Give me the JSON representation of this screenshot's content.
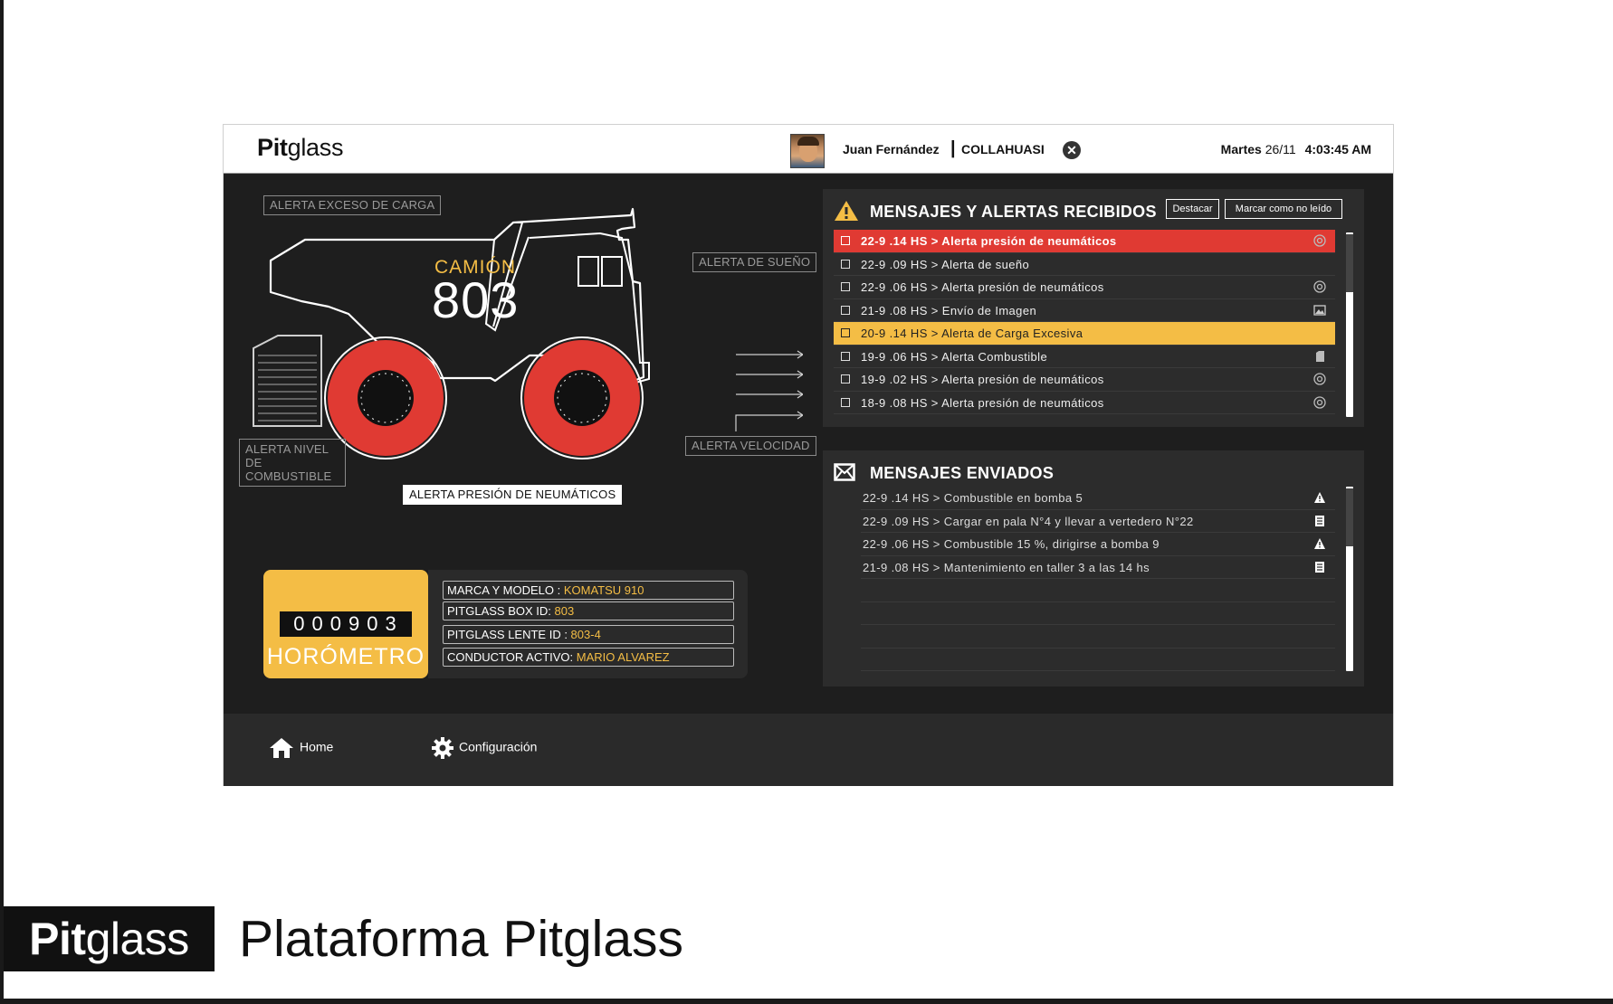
{
  "app": {
    "logo_bold": "Pit",
    "logo_rest": "glass",
    "user_name": "Juan Fernández",
    "user_sep": "|",
    "company": "COLLAHUASI",
    "day": "Martes",
    "date": "26/11",
    "time": "4:03:45 AM"
  },
  "truck": {
    "camion_label": "CAMIÓN",
    "number": "803",
    "alerts": {
      "carga": "ALERTA EXCESO DE CARGA",
      "sueno": "ALERTA DE SUEÑO",
      "combustible": "ALERTA NIVEL DE COMBUSTIBLE",
      "velocidad": "ALERTA VELOCIDAD",
      "neumaticos": "ALERTA  PRESIÓN DE NEUMÁTICOS"
    },
    "active_alert": "neumaticos"
  },
  "horometro": {
    "digits": "000903",
    "label": "HORÓMETRO"
  },
  "info": [
    {
      "label": "MARCA Y MODELO : ",
      "value": "KOMATSU 910"
    },
    {
      "label": "PITGLASS BOX ID: ",
      "value": "803"
    },
    {
      "label": "PITGLASS LENTE ID : ",
      "value": "803-4"
    },
    {
      "label": "CONDUCTOR ACTIVO: ",
      "value": "MARIO ALVAREZ"
    }
  ],
  "received": {
    "title": "MENSAJES Y ALERTAS RECIBIDOS",
    "btn_highlight": "Destacar",
    "btn_unread": "Marcar como no leído",
    "items": [
      {
        "text": "22-9 .14 HS >  Alerta presión de neumáticos",
        "icon": "tire-icon",
        "style": "red"
      },
      {
        "text": "22-9 .09 HS > Alerta de sueño",
        "icon": "",
        "style": ""
      },
      {
        "text": "22-9 .06 HS > Alerta presión de neumáticos",
        "icon": "tire-icon",
        "style": ""
      },
      {
        "text": "21-9 .08 HS > Envío de Imagen",
        "icon": "image-icon",
        "style": ""
      },
      {
        "text": "20-9 .14 HS > Alerta de Carga Excesiva",
        "icon": "",
        "style": "yellow"
      },
      {
        "text": "19-9 .06 HS > Alerta Combustible",
        "icon": "fuel-icon",
        "style": ""
      },
      {
        "text": "19-9 .02 HS > Alerta presión de neumáticos",
        "icon": "tire-icon",
        "style": ""
      },
      {
        "text": "18-9 .08 HS > Alerta presión de neumáticos",
        "icon": "tire-icon",
        "style": ""
      }
    ]
  },
  "sent": {
    "title": "MENSAJES ENVIADOS",
    "items": [
      {
        "text": "22-9 .14 HS > Combustible en bomba 5",
        "icon": "warning-icon"
      },
      {
        "text": "22-9 .09 HS > Cargar en pala N°4 y llevar a vertedero N°22",
        "icon": "document-icon"
      },
      {
        "text": "22-9 .06 HS > Combustible 15 %, dirigirse a bomba 9",
        "icon": "warning-icon"
      },
      {
        "text": "21-9 .08 HS > Mantenimiento en taller 3 a las 14 hs",
        "icon": "document-icon"
      },
      {
        "text": "",
        "icon": ""
      },
      {
        "text": "",
        "icon": ""
      },
      {
        "text": "",
        "icon": ""
      },
      {
        "text": "",
        "icon": ""
      }
    ]
  },
  "footer": {
    "home": "Home",
    "config": "Configuración"
  },
  "brand": {
    "logo_bold": "Pit",
    "logo_rest": "glass",
    "title": "Plataforma Pitglass"
  },
  "colors": {
    "accent_yellow": "#f4bd45",
    "alert_red": "#e03a33",
    "panel_dark": "#2c2c2c",
    "bg_dark": "#1e1e1e"
  }
}
